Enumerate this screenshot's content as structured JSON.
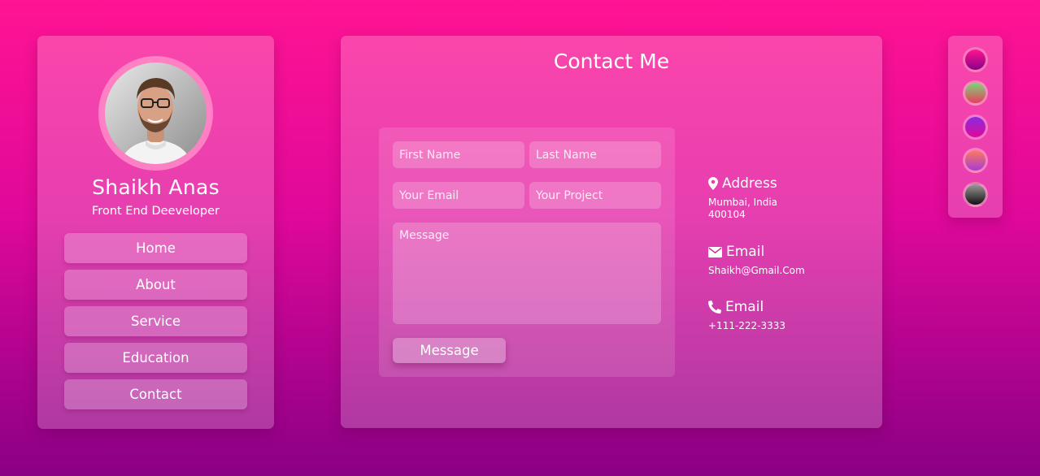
{
  "sidebar": {
    "name": "Shaikh Anas",
    "role": "Front End Deeveloper",
    "nav": [
      {
        "label": "Home"
      },
      {
        "label": "About"
      },
      {
        "label": "Service"
      },
      {
        "label": "Education"
      },
      {
        "label": "Contact"
      }
    ]
  },
  "main": {
    "title": "Contact Me",
    "form": {
      "first_name_placeholder": "First Name",
      "last_name_placeholder": "Last Name",
      "email_placeholder": "Your Email",
      "project_placeholder": "Your Project",
      "message_placeholder": "Message",
      "submit_label": "Message"
    },
    "info": {
      "address_title": "Address",
      "address_line1": "Mumbai, India",
      "address_line2": "400104",
      "email_title": "Email",
      "email_value": "Shaikh@Gmail.Com",
      "phone_title": "Email",
      "phone_value": "+111-222-3333"
    }
  },
  "themes": [
    {
      "name": "magenta",
      "colors": [
        "#ff1493",
        "#8a0085"
      ]
    },
    {
      "name": "green-red",
      "colors": [
        "#7fd37a",
        "#e6405a"
      ]
    },
    {
      "name": "purple-pink",
      "colors": [
        "#8a2be2",
        "#e0089a"
      ]
    },
    {
      "name": "orange-purple",
      "colors": [
        "#ff7a59",
        "#a63bd6"
      ]
    },
    {
      "name": "gray-black",
      "colors": [
        "#9a9a9a",
        "#111111"
      ]
    }
  ],
  "colors": {
    "bg_top": "#ff1493",
    "bg_bottom": "#8a0085",
    "ring": "#ff8cc8"
  }
}
